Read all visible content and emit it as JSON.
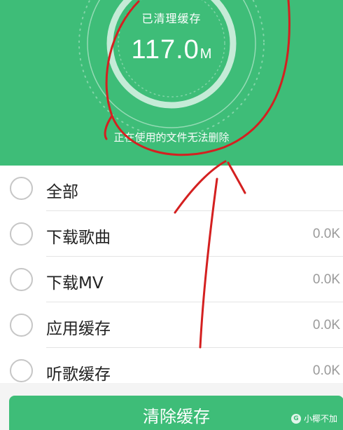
{
  "header": {
    "cleaned_label": "已清理缓存",
    "size_value": "117.0",
    "size_unit": "M",
    "note": "正在使用的文件无法删除"
  },
  "items": [
    {
      "label": "全部",
      "size": ""
    },
    {
      "label": "下载歌曲",
      "size": "0.0K"
    },
    {
      "label": "下载MV",
      "size": "0.0K"
    },
    {
      "label": "应用缓存",
      "size": "0.0K"
    },
    {
      "label": "听歌缓存",
      "size": "0.0K"
    }
  ],
  "bottom": {
    "clear_button": "清除缓存",
    "watermark": "小椰不加"
  },
  "colors": {
    "brand_green": "#3ebd78",
    "annotation_red": "#d42020"
  }
}
